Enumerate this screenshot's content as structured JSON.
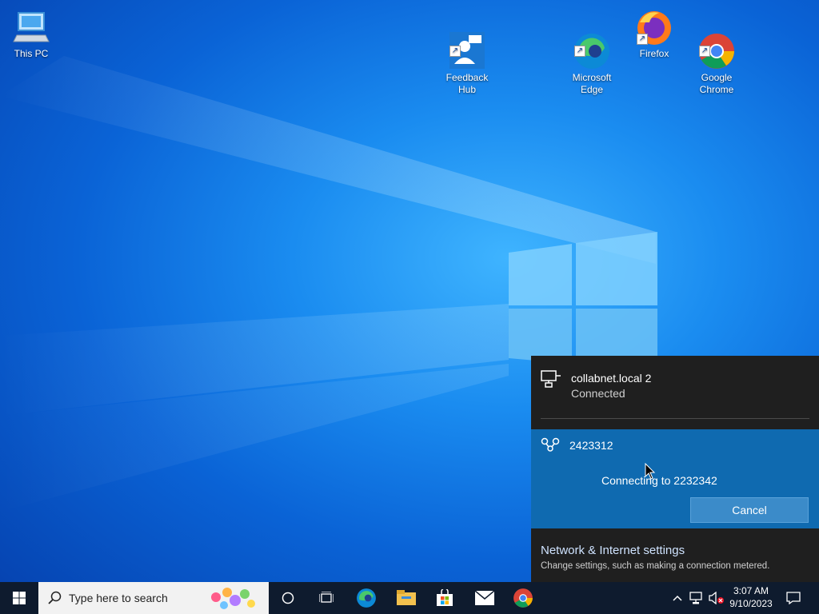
{
  "desktop": {
    "icons": [
      {
        "name": "this-pc",
        "label": "This PC"
      },
      {
        "name": "feedback-hub",
        "label": "Feedback\nHub"
      },
      {
        "name": "microsoft-edge",
        "label": "Microsoft\nEdge"
      },
      {
        "name": "firefox",
        "label": "Firefox"
      },
      {
        "name": "google-chrome",
        "label": "Google\nChrome"
      }
    ]
  },
  "network_flyout": {
    "connected_network": {
      "name": "collabnet.local 2",
      "status": "Connected"
    },
    "active_network": {
      "name": "2423312",
      "status": "Connecting to 2232342",
      "cancel_label": "Cancel"
    },
    "settings_link": "Network & Internet settings",
    "settings_sub": "Change settings, such as making a connection metered."
  },
  "taskbar": {
    "search_placeholder": "Type here to search",
    "clock": {
      "time": "3:07 AM",
      "date": "9/10/2023"
    }
  },
  "colors": {
    "taskbar_bg": "#0e1b2e",
    "flyout_bg": "#1f1f1f",
    "active_row_bg": "#0f6ab0"
  }
}
